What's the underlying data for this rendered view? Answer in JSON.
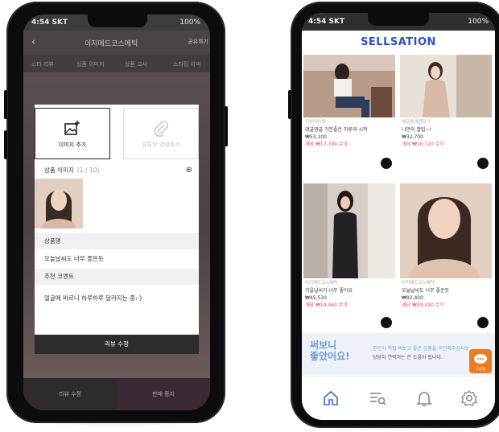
{
  "left_phone": {
    "status": {
      "time": "4:54 SKT",
      "right": "100%"
    },
    "appbar": {
      "title": "이지메드코스메틱",
      "share": "공유하기"
    },
    "tabs": [
      "스타 리뷰",
      "상품 이미지",
      "상품 교사",
      "스타킹 이미"
    ],
    "modal": {
      "add_image_label": "이미지 추가",
      "add_video_label": "유튜브 영상추가",
      "image_section_label": "상품 이미지",
      "image_count": "(1 / 10)",
      "product_name_header": "상품명",
      "product_name_value": "오늘날씨도 너무 좋은듯",
      "comment_header": "추천 코멘트",
      "comment_value": "얼굴에 바르니 하루하루 달라지는 중:-)",
      "submit_label": "리뷰 수정"
    },
    "bottom": {
      "left": "리뷰 수정",
      "right": "판매 중지"
    }
  },
  "right_phone": {
    "status": {
      "time": "4:54 SKT",
      "right": "100%"
    },
    "brand": "SELLSATION",
    "cards": [
      {
        "shop": "지영미마켓",
        "name": "댕글댕글 기본좋은 하루의 시작",
        "price": "₩53,100",
        "earn": "개당 ₩17,790 수익",
        "tint": "#8e6f64"
      },
      {
        "shop": "에코동애원하니",
        "name": "나만의 꿀팁~!",
        "price": "₩32,700",
        "earn": "개당 ₩10,720 수익",
        "tint": "#c8b09f"
      },
      {
        "shop": "이지메드코스메틱",
        "name": "가을날씨가 너무 좋아요",
        "price": "₩45,530",
        "earn": "개당 ₩14,460 수익",
        "tint": "#5e5452"
      },
      {
        "shop": "이지메드코스메틱",
        "name": "오늘날씨도 너무 좋은듯",
        "price": "₩92,400",
        "earn": "개당 ₩29,290 수익",
        "tint": "#d7b8a6"
      }
    ],
    "banner": {
      "title_line1": "써보니",
      "title_line2": "좋았어요!",
      "line1": "본인이 직접 써보고 좋은 상품을 추천해주십시오.",
      "line2": "당담자 연락처는 큰 도움이 됩니다."
    },
    "chat_label": "톡상담",
    "tabs": [
      "home-icon",
      "list-search-icon",
      "bell-icon",
      "gear-icon"
    ],
    "accent": "#2b4fc7",
    "earn_color": "#e8466b",
    "chat_color": "#ef7a20"
  }
}
